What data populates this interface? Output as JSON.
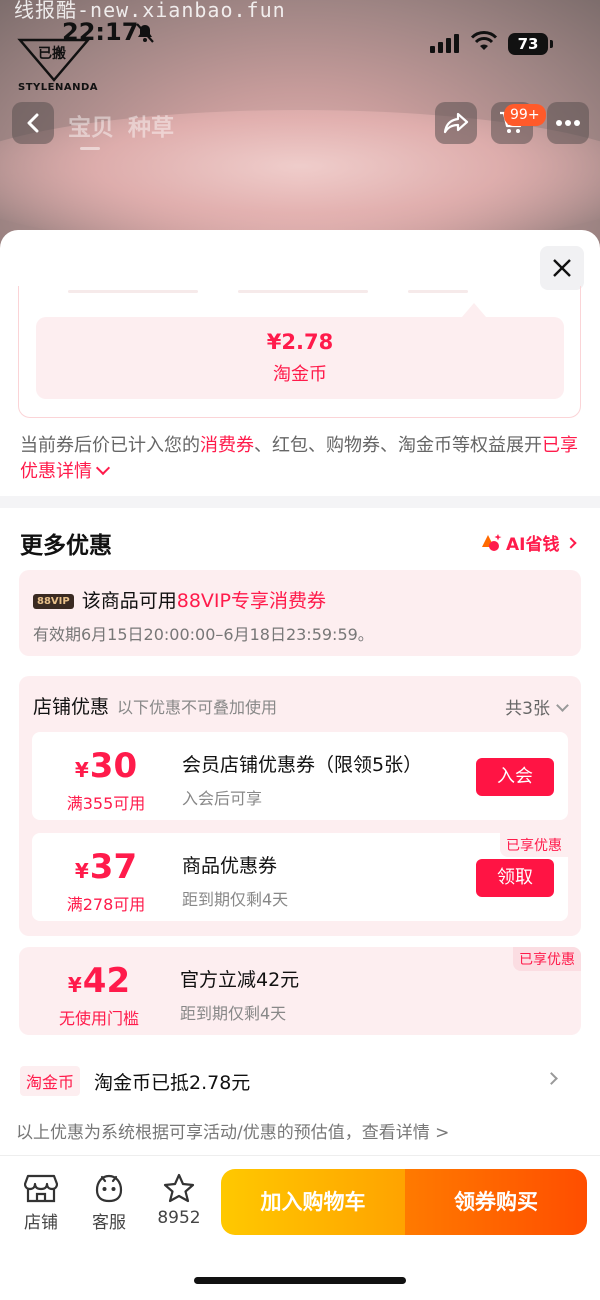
{
  "status_bar": {
    "time": "22:17",
    "battery": "73",
    "watermark": "线报酷-new.xianbao.fun"
  },
  "logo": {
    "brand": "STYLENANDA",
    "mark": "已搬"
  },
  "nav": {
    "tabs": [
      "宝贝",
      "种草"
    ],
    "cart_badge": "99+"
  },
  "price_box": {
    "amount": "¥2.78",
    "label": "淘金币"
  },
  "benefit_note": {
    "prefix": "当前券后价已计入您的",
    "highlight": "消费券",
    "suffix": "、红包、购物券、淘金币等权益展开",
    "link": "已享优惠详情"
  },
  "more_offers": {
    "title": "更多优惠",
    "ai_label": "AI省钱"
  },
  "vip_card": {
    "tag": "88VIP",
    "title_prefix": "该商品可用",
    "title_highlight": "88VIP专享消费券",
    "validity": "有效期6月15日20:00:00–6月18日23:59:59。"
  },
  "store_offers": {
    "title": "店铺优惠",
    "subtitle": "以下优惠不可叠加使用",
    "count": "共3张",
    "coupons": [
      {
        "currency": "¥",
        "value": "30",
        "condition": "满355可用",
        "title": "会员店铺优惠券（限领5张）",
        "sub": "入会后可享",
        "button": "入会"
      },
      {
        "currency": "¥",
        "value": "37",
        "condition": "满278可用",
        "title": "商品优惠券",
        "sub": "距到期仅剩4天",
        "button": "领取",
        "badge": "已享优惠"
      }
    ]
  },
  "official_discount": {
    "currency": "¥",
    "value": "42",
    "condition": "无使用门槛",
    "title": "官方立减42元",
    "sub": "距到期仅剩4天",
    "badge": "已享优惠"
  },
  "coin_row": {
    "tag": "淘金币",
    "text": "淘金币已抵2.78元"
  },
  "footnote": "以上优惠为系统根据可享活动/优惠的预估值，查看详情 >",
  "bottom_bar": {
    "store": "店铺",
    "service": "客服",
    "favorites": "8952",
    "add_cart": "加入购物车",
    "buy": "领券购买"
  }
}
